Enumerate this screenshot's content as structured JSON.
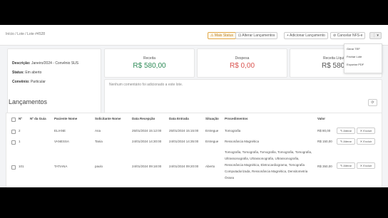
{
  "breadcrumb": "Início / Lote / Lote #4528",
  "toolbar": {
    "status_btn": "⚠ Mais Status",
    "change_btn": "⊡ Alterar Lançamentos",
    "add_btn": "+ Adicionar Lançamento",
    "cancel_btn": "⊘ Cancelar NFS-e",
    "more_btn": "⋮ ▾"
  },
  "dropdown": {
    "item1": "Gerar TEF",
    "item2": "Fechar Lote",
    "item3": "Exportar PDF"
  },
  "info": {
    "descricao_label": "Descrição:",
    "descricao_value": "Janeiro/2024 - Convênio SUS",
    "status_label": "Status:",
    "status_value": "Em aberto",
    "convenio_label": "Convênio:",
    "convenio_value": "Particular"
  },
  "finance": {
    "receita_label": "Receita",
    "receita_value": "R$ 580,00",
    "receita_color": "#2e8b57",
    "despesa_label": "Despesa",
    "despesa_value": "R$ 0,00",
    "despesa_color": "#d9534f",
    "liquida_label": "Receita Líquida",
    "liquida_value": "R$ 580,00"
  },
  "note": "Nenhum comentário foi adicionado a este lote.",
  "lancamentos": {
    "title": "Lançamentos",
    "refresh_icon": "⟳",
    "columns": [
      "Nº",
      "Nº da Guia",
      "Paciente Nome",
      "Solicitante Nome",
      "Data Recepção",
      "Data Entrada",
      "Situação",
      "Procedimentos",
      "Valor"
    ],
    "rows": [
      {
        "n": "2",
        "guia": "",
        "paciente": "ELIANE",
        "solicitante": "Ana",
        "recepcao": "25/01/2024 15:12:00",
        "entrada": "25/01/2024 15:15:00",
        "situacao": "Entregue",
        "procedimentos": "Tomografia",
        "valor": "R$ 80,00"
      },
      {
        "n": "1",
        "guia": "",
        "paciente": "VANESSA",
        "solicitante": "Tania",
        "recepcao": "24/01/2024 14:30:00",
        "entrada": "24/01/2024 14:35:00",
        "situacao": "Entregue",
        "procedimentos": "Ressonância Magnética",
        "valor": "R$ 150,00"
      },
      {
        "n": "101",
        "guia": "",
        "paciente": "TATIANA",
        "solicitante": "paulo",
        "recepcao": "24/01/2024 09:18:00",
        "entrada": "24/01/2024 09:20:00",
        "situacao": "Aberto",
        "procedimentos": "Tomografia, Tomografia, Tomografia, Tomografia, Tomografia, Ultrassonografia, Ultrassonografia, Ultrassonografia, Ressonância Magnética, Eletrocardiograma, Tomografia Computadorizada, Ressonância Magnética, Densitometria Óssea",
        "valor": "R$ 350,00"
      }
    ],
    "action_change": "✎ Alterar",
    "action_delete": "✕ Excluir"
  }
}
